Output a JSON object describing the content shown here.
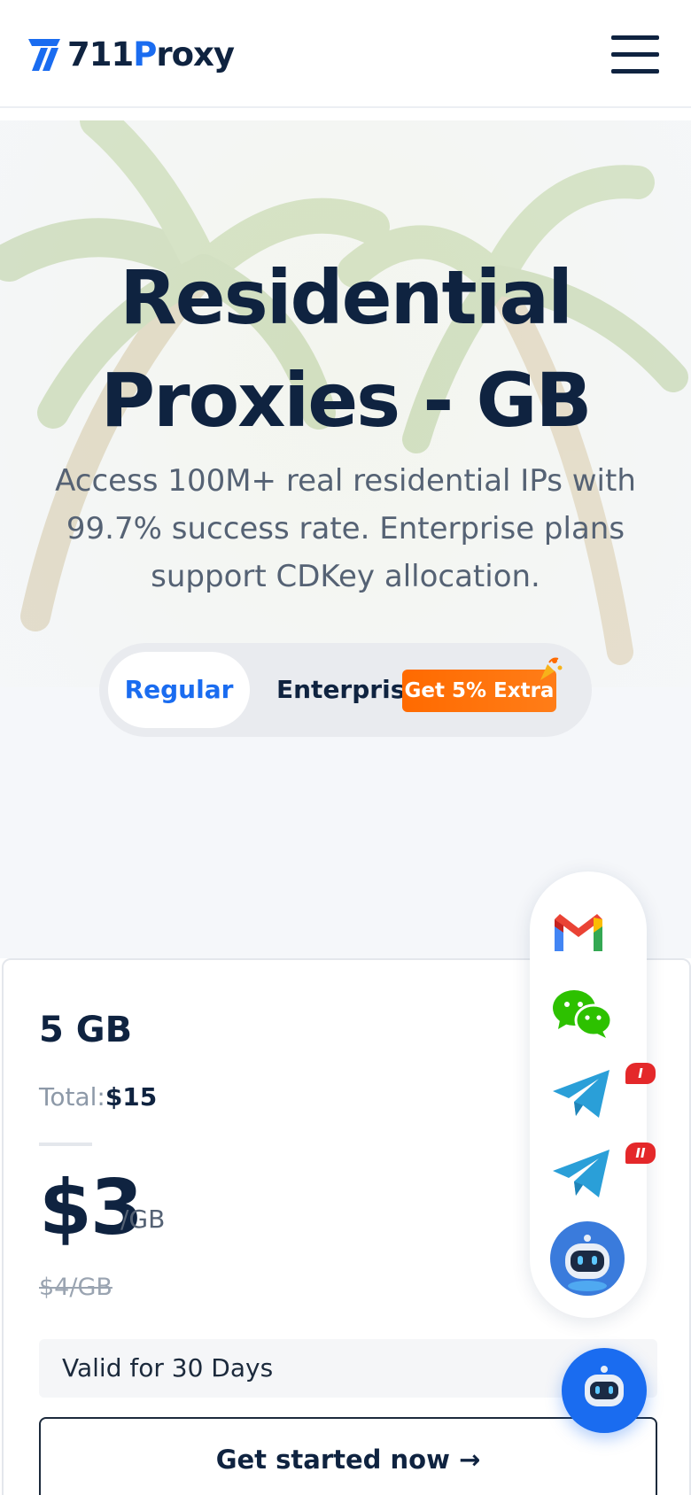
{
  "header": {
    "logo_prefix": "711",
    "logo_p": "P",
    "logo_suffix": "roxy",
    "menu_icon": "hamburger-icon"
  },
  "hero": {
    "title": "Residential Proxies - GB",
    "subtitle": "Access 100M+ real residential IPs with 99.7% success rate. Enterprise plans support CDKey allocation.",
    "toggle": {
      "regular_label": "Regular",
      "enterprise_label": "Enterprise",
      "badge_label": "Get 5% Extra",
      "selected": "Regular"
    }
  },
  "plan": {
    "name": "5 GB",
    "total_label": "Total:",
    "total_value": "$15",
    "price": "$3",
    "price_unit": "/GB",
    "old_price": "$4/GB",
    "validity": "Valid for 30 Days",
    "cta_label": "Get started now"
  },
  "contacts": {
    "items": [
      "gmail-icon",
      "wechat-icon",
      "telegram-icon",
      "telegram-icon",
      "robot-assistant-icon"
    ],
    "tg_badge_1": "I",
    "tg_badge_2": "II"
  },
  "colors": {
    "brand_blue": "#1a6cf0",
    "navy_text": "#0f2340",
    "badge_orange": "#ff6a00"
  }
}
